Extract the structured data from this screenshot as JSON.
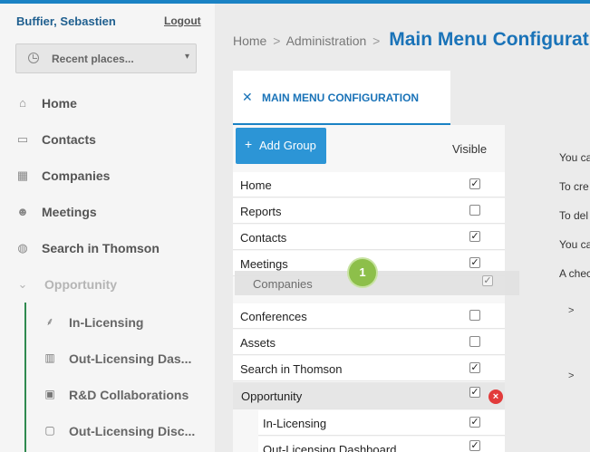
{
  "user": {
    "name": "Buffier, Sebastien",
    "logout": "Logout"
  },
  "recent": {
    "label": "Recent places...",
    "caret": "▾"
  },
  "nav": [
    {
      "label": "Home",
      "icon": "home-icon",
      "glyph": "⌂"
    },
    {
      "label": "Contacts",
      "icon": "contacts-icon",
      "glyph": "▭"
    },
    {
      "label": "Companies",
      "icon": "building-icon",
      "glyph": "▦"
    },
    {
      "label": "Meetings",
      "icon": "people-icon",
      "glyph": "☻"
    },
    {
      "label": "Search in Thomson",
      "icon": "globe-icon",
      "glyph": "◍"
    },
    {
      "label": "Opportunity",
      "icon": "chevron-down-icon",
      "glyph": "⌄"
    }
  ],
  "subnav": [
    {
      "label": "In-Licensing",
      "icon": "hierarchy-icon",
      "glyph": "⸙"
    },
    {
      "label": "Out-Licensing Das...",
      "icon": "chart-icon",
      "glyph": "▥"
    },
    {
      "label": "R&D Collaborations",
      "icon": "grid-icon",
      "glyph": "▣"
    },
    {
      "label": "Out-Licensing Disc...",
      "icon": "chat-icon",
      "glyph": "▢"
    }
  ],
  "breadcrumb": {
    "home": "Home",
    "sep": ">",
    "admin": "Administration",
    "title": "Main Menu Configuration"
  },
  "tab": {
    "label": "MAIN MENU CONFIGURATION",
    "glyph": "✕"
  },
  "toolbar": {
    "add_group": "Add Group",
    "plus": "+",
    "visible": "Visible"
  },
  "rows": [
    {
      "label": "Home",
      "checked": "✓"
    },
    {
      "label": "Reports",
      "checked": ""
    },
    {
      "label": "Contacts",
      "checked": "✓"
    },
    {
      "label": "Meetings",
      "checked": "✓"
    },
    {
      "label": "Conferences",
      "checked": ""
    },
    {
      "label": "Assets",
      "checked": ""
    },
    {
      "label": "Search in Thomson",
      "checked": "✓"
    },
    {
      "label": "Opportunity",
      "checked": "✓"
    },
    {
      "label": "In-Licensing",
      "checked": "✓"
    },
    {
      "label": "Out-Licensing Dashboard",
      "checked": "✓"
    }
  ],
  "dragging": {
    "label": "Companies",
    "checked": "✓"
  },
  "badge": "1",
  "remove_glyph": "×",
  "help": [
    "You ca",
    "To cre",
    "To del",
    "You ca",
    "A chec"
  ],
  "chevrons": [
    ">",
    ">"
  ],
  "colors": {
    "accent": "#1a82c4",
    "button": "#2c95d6",
    "badge": "#8dbf4a",
    "remove": "#e23b3b"
  }
}
